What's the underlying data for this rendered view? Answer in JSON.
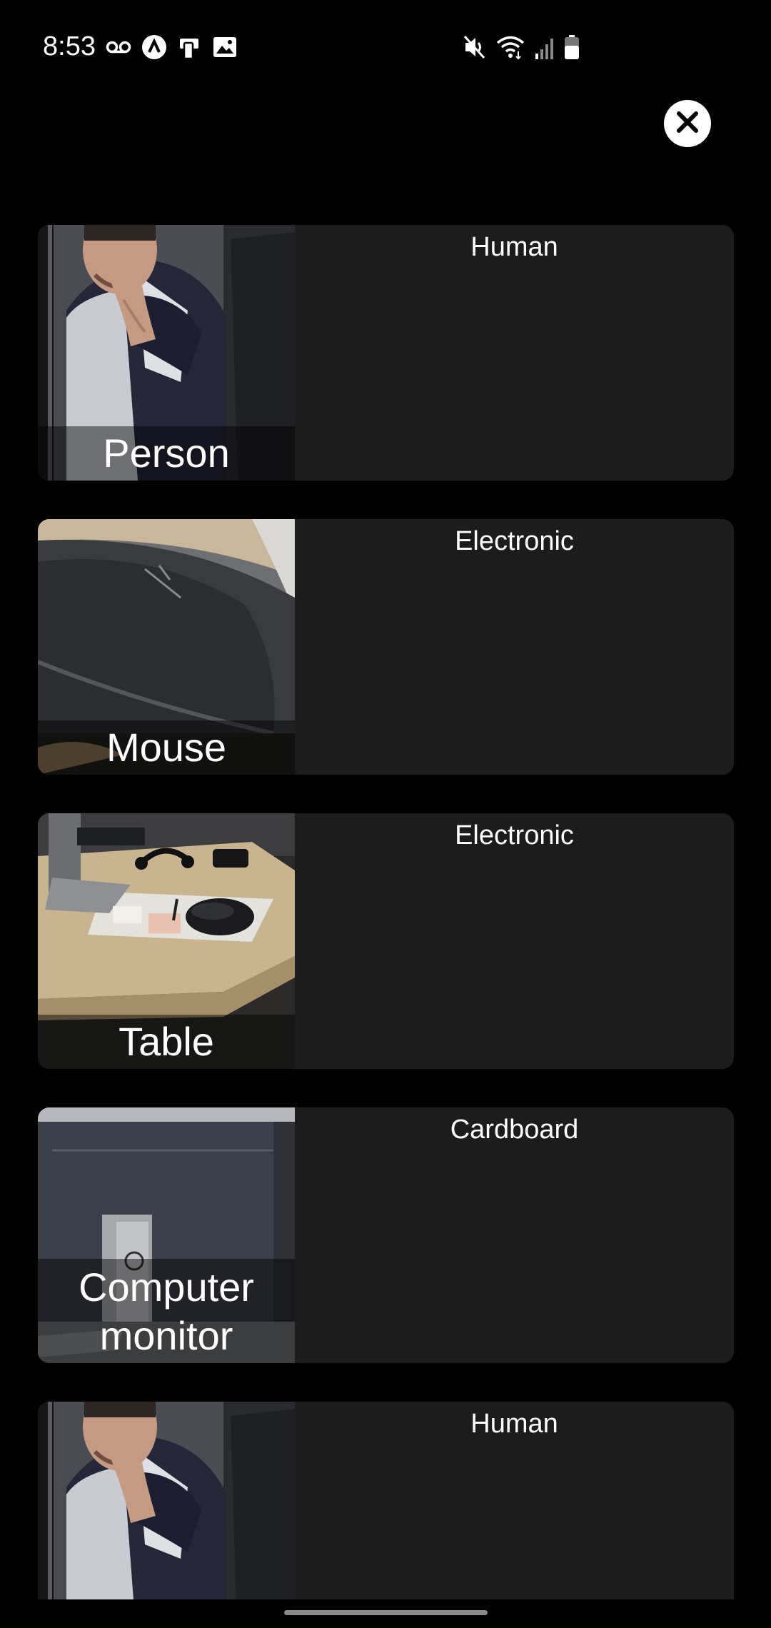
{
  "status_bar": {
    "time": "8:53",
    "left_icons": [
      "voicemail-icon",
      "assistant-icon",
      "phone-stack-icon",
      "image-icon"
    ],
    "right_icons": [
      "mute-icon",
      "wifi-icon",
      "signal-icon",
      "battery-icon"
    ]
  },
  "close_button": {
    "icon": "close-icon"
  },
  "results": [
    {
      "label": "Person",
      "category": "Human",
      "thumbnail": "person-photo"
    },
    {
      "label": "Mouse",
      "category": "Electronic",
      "thumbnail": "mouse-photo"
    },
    {
      "label": "Table",
      "category": "Electronic",
      "thumbnail": "desk-photo"
    },
    {
      "label": "Computer monitor",
      "category": "Cardboard",
      "thumbnail": "monitor-photo"
    },
    {
      "label": "",
      "category": "Human",
      "thumbnail": "person-photo"
    }
  ],
  "colors": {
    "background": "#000000",
    "card": "#1c1c1d",
    "text": "#ffffff"
  }
}
